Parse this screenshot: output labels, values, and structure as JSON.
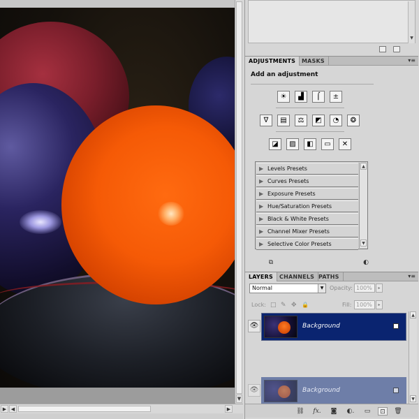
{
  "panel": {
    "top_sub": {
      "scroll_down": "▼",
      "new_icon": "new-icon",
      "trash_icon": "trash-icon"
    },
    "adjustments": {
      "tabs": [
        "ADJUSTMENTS",
        "MASKS"
      ],
      "menu_glyph": "▾≡",
      "title": "Add an adjustment",
      "row1_icons": [
        "brightness-contrast-icon",
        "levels-icon",
        "curves-icon",
        "exposure-icon"
      ],
      "row1_glyphs": [
        "☀",
        "▟",
        "⌠",
        "±"
      ],
      "row2_icons": [
        "vibrance-icon",
        "hue-saturation-icon",
        "color-balance-icon",
        "black-white-icon",
        "photo-filter-icon",
        "channel-mixer-icon"
      ],
      "row2_glyphs": [
        "∇",
        "▤",
        "⚖",
        "◩",
        "◔",
        "❂"
      ],
      "row3_icons": [
        "invert-icon",
        "posterize-icon",
        "threshold-icon",
        "gradient-map-icon",
        "selective-color-icon"
      ],
      "row3_glyphs": [
        "◪",
        "▨",
        "◧",
        "▭",
        "✕"
      ],
      "presets": [
        "Levels Presets",
        "Curves Presets",
        "Exposure Presets",
        "Hue/Saturation Presets",
        "Black & White Presets",
        "Channel Mixer Presets",
        "Selective Color Presets"
      ],
      "preset_triangle": "▶",
      "scroll_up": "▲",
      "scroll_down": "▼",
      "footer_icons": [
        "clip-to-layer-icon",
        "view-previous-icon"
      ],
      "footer_glyphs": [
        "⧉",
        "◐"
      ]
    },
    "layers": {
      "tabs": [
        "LAYERS",
        "CHANNELS",
        "PATHS"
      ],
      "menu_glyph": "▾≡",
      "blend_mode": "Normal",
      "dropdown_glyph": "▼",
      "opacity_label": "Opacity:",
      "opacity_value": "100%",
      "lock_label": "Lock:",
      "fill_label": "Fill:",
      "fill_value": "100%",
      "step_glyph": "▸",
      "lock_glyphs": [
        "□",
        "✎",
        "✥",
        "🔒"
      ],
      "layers": [
        {
          "name": "Background",
          "selected": true,
          "visible_glyph": "👁"
        },
        {
          "name": "Background",
          "selected": false,
          "visible_glyph": "👁"
        }
      ],
      "scroll_up": "▲",
      "scroll_down": "▼",
      "footer_icons": [
        "link-layers-icon",
        "fx-icon",
        "add-mask-icon",
        "new-adjustment-icon",
        "new-group-icon",
        "new-layer-icon",
        "delete-layer-icon"
      ],
      "footer_glyphs": [
        "⛓",
        "fx.",
        "◙",
        "◐.",
        "▭",
        "⊡",
        "🗑"
      ]
    }
  },
  "document": {
    "scroll_right": "▶",
    "scroll_left": "◀",
    "scroll_down": "▼"
  },
  "colors": {
    "selected_layer_bg": "#0a2470",
    "unselected_layer_bg": "#6e7ea8",
    "panel_bg": "#d6d6d6",
    "tab_bar_bg": "#bdbdbd"
  }
}
